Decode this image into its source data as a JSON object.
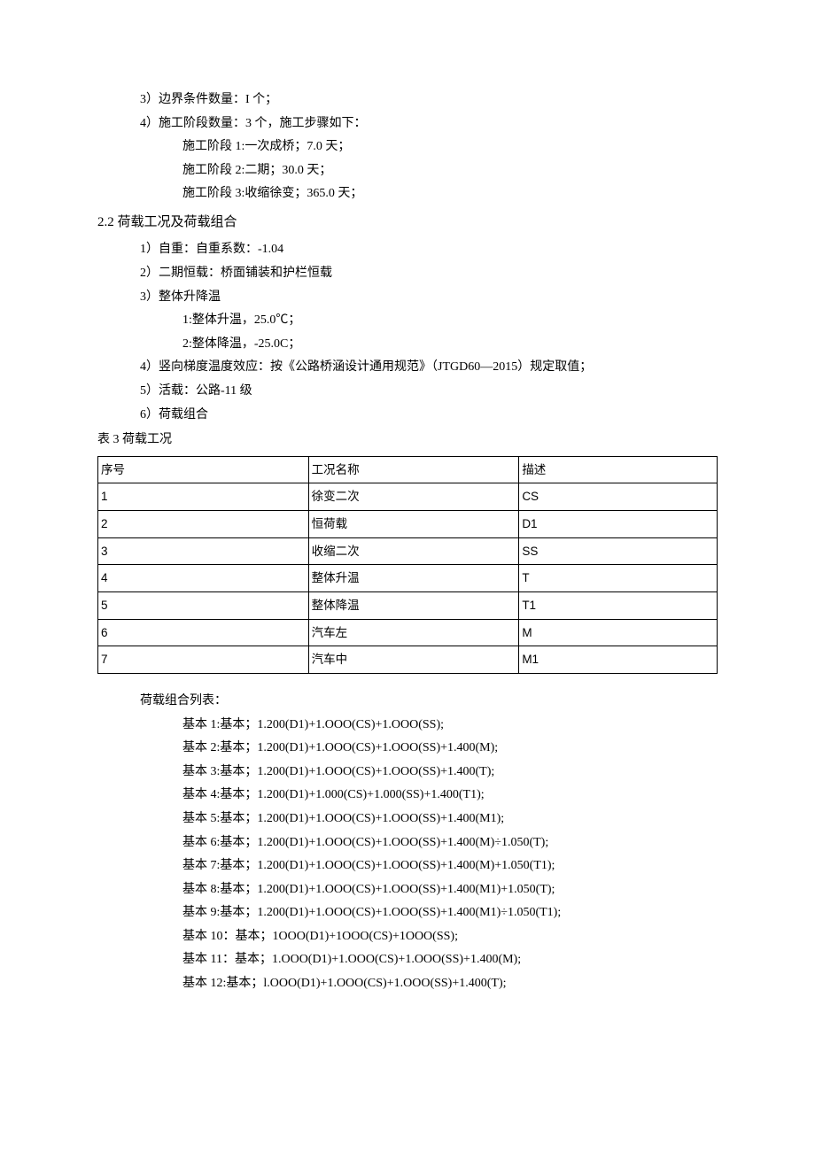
{
  "top": {
    "item3": "3）边界条件数量：I 个；",
    "item4": "4）施工阶段数量：3 个，施工步骤如下：",
    "stage1": "施工阶段 1:一次成桥；7.0 天；",
    "stage2": "施工阶段 2:二期；30.0 天；",
    "stage3": "施工阶段 3:收缩徐变；365.0 天；"
  },
  "section22": {
    "heading": "2.2 荷载工况及荷载组合",
    "item1": "1）自重：自重系数：-1.04",
    "item2": "2）二期恒载：桥面铺装和护栏恒载",
    "item3": "3）整体升降温",
    "item3a": "1:整体升温，25.0℃；",
    "item3b": "2:整体降温，-25.0C；",
    "item4": "4）竖向梯度温度效应：按《公路桥涵设计通用规范》（JTGD60—2015）规定取值；",
    "item5": "5）活载：公路-11 级",
    "item6": "6）荷载组合"
  },
  "table3": {
    "caption": "表 3 荷载工况",
    "header": {
      "c1": "序号",
      "c2": "工况名称",
      "c3": "描述"
    },
    "rows": [
      {
        "c1": "1",
        "c2": "徐变二次",
        "c3": "CS"
      },
      {
        "c1": "2",
        "c2": "恒荷载",
        "c3": "D1"
      },
      {
        "c1": "3",
        "c2": "收缩二次",
        "c3": "SS"
      },
      {
        "c1": "4",
        "c2": "整体升温",
        "c3": "T"
      },
      {
        "c1": "5",
        "c2": "整体降温",
        "c3": "T1"
      },
      {
        "c1": "6",
        "c2": "汽车左",
        "c3": "M"
      },
      {
        "c1": "7",
        "c2": "汽车中",
        "c3": "M1"
      }
    ]
  },
  "combos": {
    "title": "荷载组合列表：",
    "items": [
      "基本 1:基本；1.200(D1)+1.OOO(CS)+1.OOO(SS);",
      "基本 2:基本；1.200(D1)+1.OOO(CS)+1.OOO(SS)+1.400(M);",
      "基本 3:基本；1.200(D1)+1.OOO(CS)+1.OOO(SS)+1.400(T);",
      "基本 4:基本；1.200(D1)+1.000(CS)+1.000(SS)+1.400(T1);",
      "基本 5:基本；1.200(D1)+1.OOO(CS)+1.OOO(SS)+1.400(M1);",
      "基本 6:基本；1.200(D1)+1.OOO(CS)+1.OOO(SS)+1.400(M)÷1.050(T);",
      "基本 7:基本；1.200(D1)+1.OOO(CS)+1.OOO(SS)+1.400(M)+1.050(T1);",
      "基本 8:基本；1.200(D1)+1.OOO(CS)+1.OOO(SS)+1.400(M1)+1.050(T);",
      "基本 9:基本；1.200(D1)+1.OOO(CS)+1.OOO(SS)+1.400(M1)÷1.050(T1);",
      "基本 10：基本；1OOO(D1)+1OOO(CS)+1OOO(SS);",
      "基本 11：基本；1.OOO(D1)+1.OOO(CS)+1.OOO(SS)+1.400(M);",
      "基本 12:基本；l.OOO(D1)+1.OOO(CS)+1.OOO(SS)+1.400(T);"
    ]
  }
}
